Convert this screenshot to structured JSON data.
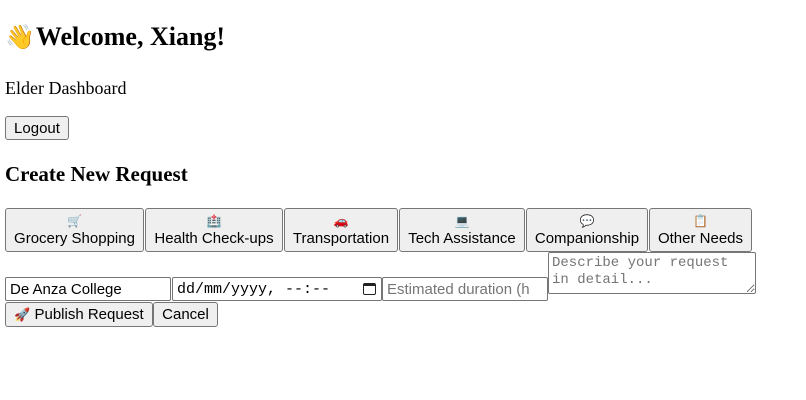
{
  "header": {
    "wave_icon": "👋",
    "greeting": "Welcome, Xiang!",
    "subtitle": "Elder Dashboard",
    "logout_label": "Logout"
  },
  "request_form": {
    "title": "Create New Request",
    "categories": [
      {
        "icon": "🛒",
        "icon_name": "shopping-cart-icon",
        "label": "Grocery Shopping"
      },
      {
        "icon": "🏥",
        "icon_name": "hospital-icon",
        "label": "Health Check-ups"
      },
      {
        "icon": "🚗",
        "icon_name": "car-icon",
        "label": "Transportation"
      },
      {
        "icon": "💻",
        "icon_name": "laptop-icon",
        "label": "Tech Assistance"
      },
      {
        "icon": "💬",
        "icon_name": "speech-bubble-icon",
        "label": "Companionship"
      },
      {
        "icon": "📋",
        "icon_name": "clipboard-icon",
        "label": "Other Needs"
      }
    ],
    "location_value": "De Anza College",
    "datetime_placeholder": "dd/mm/yyyy, --:--",
    "duration_placeholder": "Estimated duration (h",
    "details_placeholder": "Describe your request in detail...",
    "publish_icon": "🚀",
    "publish_label": "Publish Request",
    "cancel_label": "Cancel"
  }
}
